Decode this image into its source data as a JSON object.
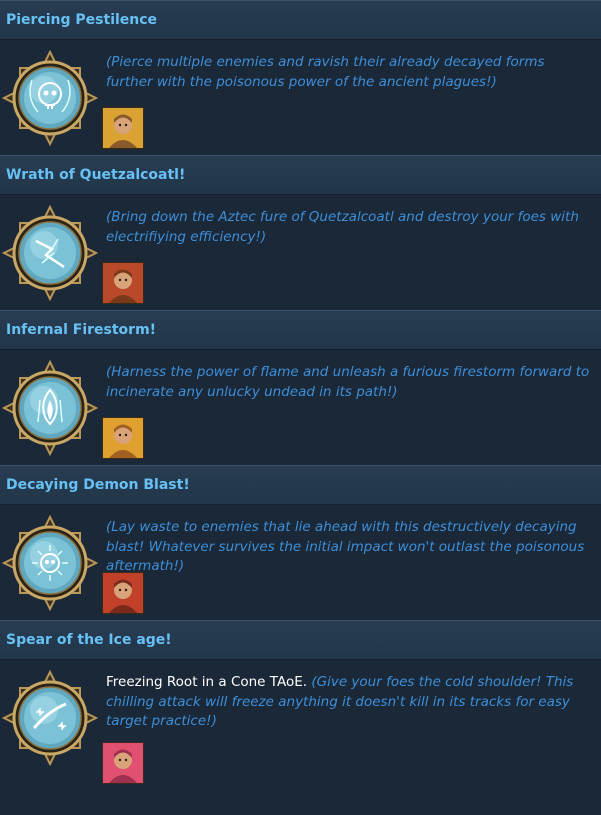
{
  "colors": {
    "background": "#1b2838",
    "header_bg": "#22364a",
    "title_text": "#67c1f5",
    "description_text": "#3d8fd9",
    "plain_text": "#ffffff",
    "emblem_gold": "#b8975a"
  },
  "abilities": [
    {
      "title": "Piercing Pestilence",
      "effect": "",
      "description": "(Pierce multiple enemies and ravish their already decayed forms further with the poisonous power of the ancient plagues!)",
      "icon": "skull-icon",
      "portrait": "mustached-man-portrait",
      "portrait_colors": [
        "#d9a233",
        "#8a5a2b"
      ]
    },
    {
      "title": "Wrath of Quetzalcoatl!",
      "effect": "",
      "description": "(Bring down the Aztec fure of Quetzalcoatl and destroy your foes with electrifiying efficiency!)",
      "icon": "lightning-icon",
      "portrait": "cowboy-portrait",
      "portrait_colors": [
        "#b84a2a",
        "#7a3a1a"
      ]
    },
    {
      "title": "Infernal Firestorm!",
      "effect": "",
      "description": "(Harness the power of flame and unleash a furious firestorm forward to incinerate any unlucky undead in its path!)",
      "icon": "flame-icon",
      "portrait": "grinning-man-portrait",
      "portrait_colors": [
        "#e0a030",
        "#a06020"
      ]
    },
    {
      "title": "Decaying Demon Blast!",
      "effect": "",
      "description": "(Lay waste to enemies that lie ahead with this destructively decaying blast! Whatever survives the initial impact won't outlast the poisonous aftermath!)",
      "icon": "skull-burst-icon",
      "portrait": "bearded-man-portrait",
      "portrait_colors": [
        "#c0402a",
        "#7a2a1a"
      ]
    },
    {
      "title": "Spear of the Ice age!",
      "effect": "Freezing Root in a Cone TAoE. ",
      "description": "(Give your foes the cold shoulder! This chilling attack will freeze anything it doesn't kill in its tracks for easy target practice!)",
      "icon": "ice-comet-icon",
      "portrait": "woman-portrait",
      "portrait_colors": [
        "#e05070",
        "#a03050"
      ]
    }
  ]
}
